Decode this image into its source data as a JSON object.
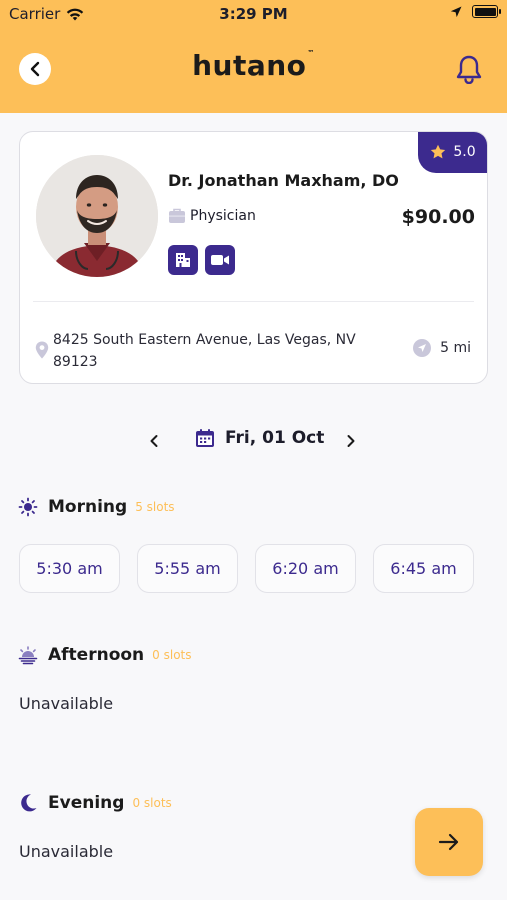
{
  "status_bar": {
    "carrier": "Carrier",
    "time": "3:29 PM"
  },
  "header": {
    "logo": "hutano",
    "logo_mark": "™"
  },
  "provider": {
    "name": "Dr. Jonathan Maxham, DO",
    "specialty": "Physician",
    "price": "$90.00",
    "rating": "5.0",
    "address": "8425 South Eastern Avenue, Las Vegas, NV 89123",
    "distance": "5 mi",
    "appointment_modes": [
      "building-icon",
      "video-camera-icon"
    ]
  },
  "date_picker": {
    "selected_date": "Fri, 01 Oct"
  },
  "sections": {
    "morning": {
      "title": "Morning",
      "slots_label": "5 slots",
      "times": [
        "5:30 am",
        "5:55 am",
        "6:20 am",
        "6:45 am"
      ]
    },
    "afternoon": {
      "title": "Afternoon",
      "slots_label": "0 slots",
      "status": "Unavailable"
    },
    "evening": {
      "title": "Evening",
      "slots_label": "0 slots",
      "status": "Unavailable"
    }
  },
  "colors": {
    "brand_yellow": "#fdbf58",
    "brand_purple": "#3c2a8e",
    "background": "#f8f8fa"
  }
}
